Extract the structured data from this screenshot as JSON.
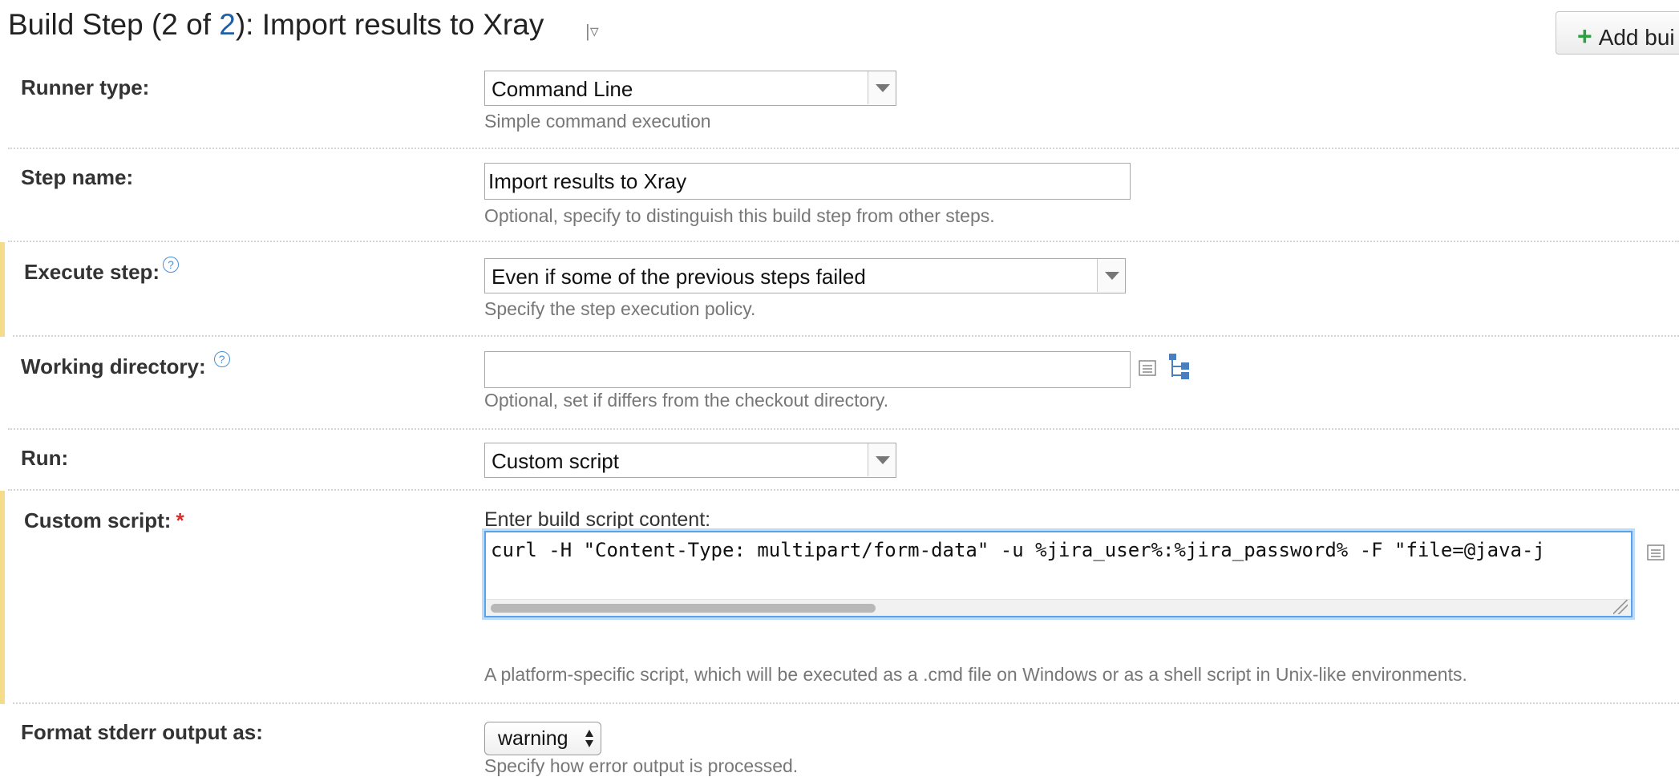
{
  "header": {
    "title_prefix": "Build Step (2 of ",
    "title_link": "2",
    "title_suffix": "): Import results to Xray",
    "menu_glyph": "|▿",
    "add_button_label": "Add bui"
  },
  "fields": {
    "runner_type": {
      "label": "Runner type:",
      "value": "Command Line",
      "note": "Simple command execution"
    },
    "step_name": {
      "label": "Step name:",
      "value": "Import results to Xray",
      "note": "Optional, specify to distinguish this build step from other steps."
    },
    "execute_step": {
      "label": "Execute step:",
      "value": "Even if some of the previous steps failed",
      "note": "Specify the step execution policy."
    },
    "working_directory": {
      "label": "Working directory:",
      "value": "",
      "note": "Optional, set if differs from the checkout directory."
    },
    "run": {
      "label": "Run:",
      "value": "Custom script"
    },
    "custom_script": {
      "label": "Custom script:",
      "required_mark": "*",
      "prompt": "Enter build script content:",
      "content": "curl -H \"Content-Type: multipart/form-data\" -u %jira_user%:%jira_password% -F \"file=@java-j",
      "note": "A platform-specific script, which will be executed as a .cmd file on Windows or as a shell script in Unix-like environments."
    },
    "format_stderr": {
      "label": "Format stderr output as:",
      "value": "warning",
      "note": "Specify how error output is processed."
    }
  },
  "help_glyph": "?",
  "colors": {
    "link": "#1f5fa6",
    "highlight_bar": "#f4dc8a",
    "focus_border": "#5aa2ec",
    "add_plus": "#2ea043",
    "required": "#d32f2f"
  },
  "icons": {
    "title_menu": "dropdown-menu-icon",
    "add": "plus-icon",
    "help": "help-icon",
    "list": "list-icon",
    "tree": "directory-tree-icon"
  }
}
